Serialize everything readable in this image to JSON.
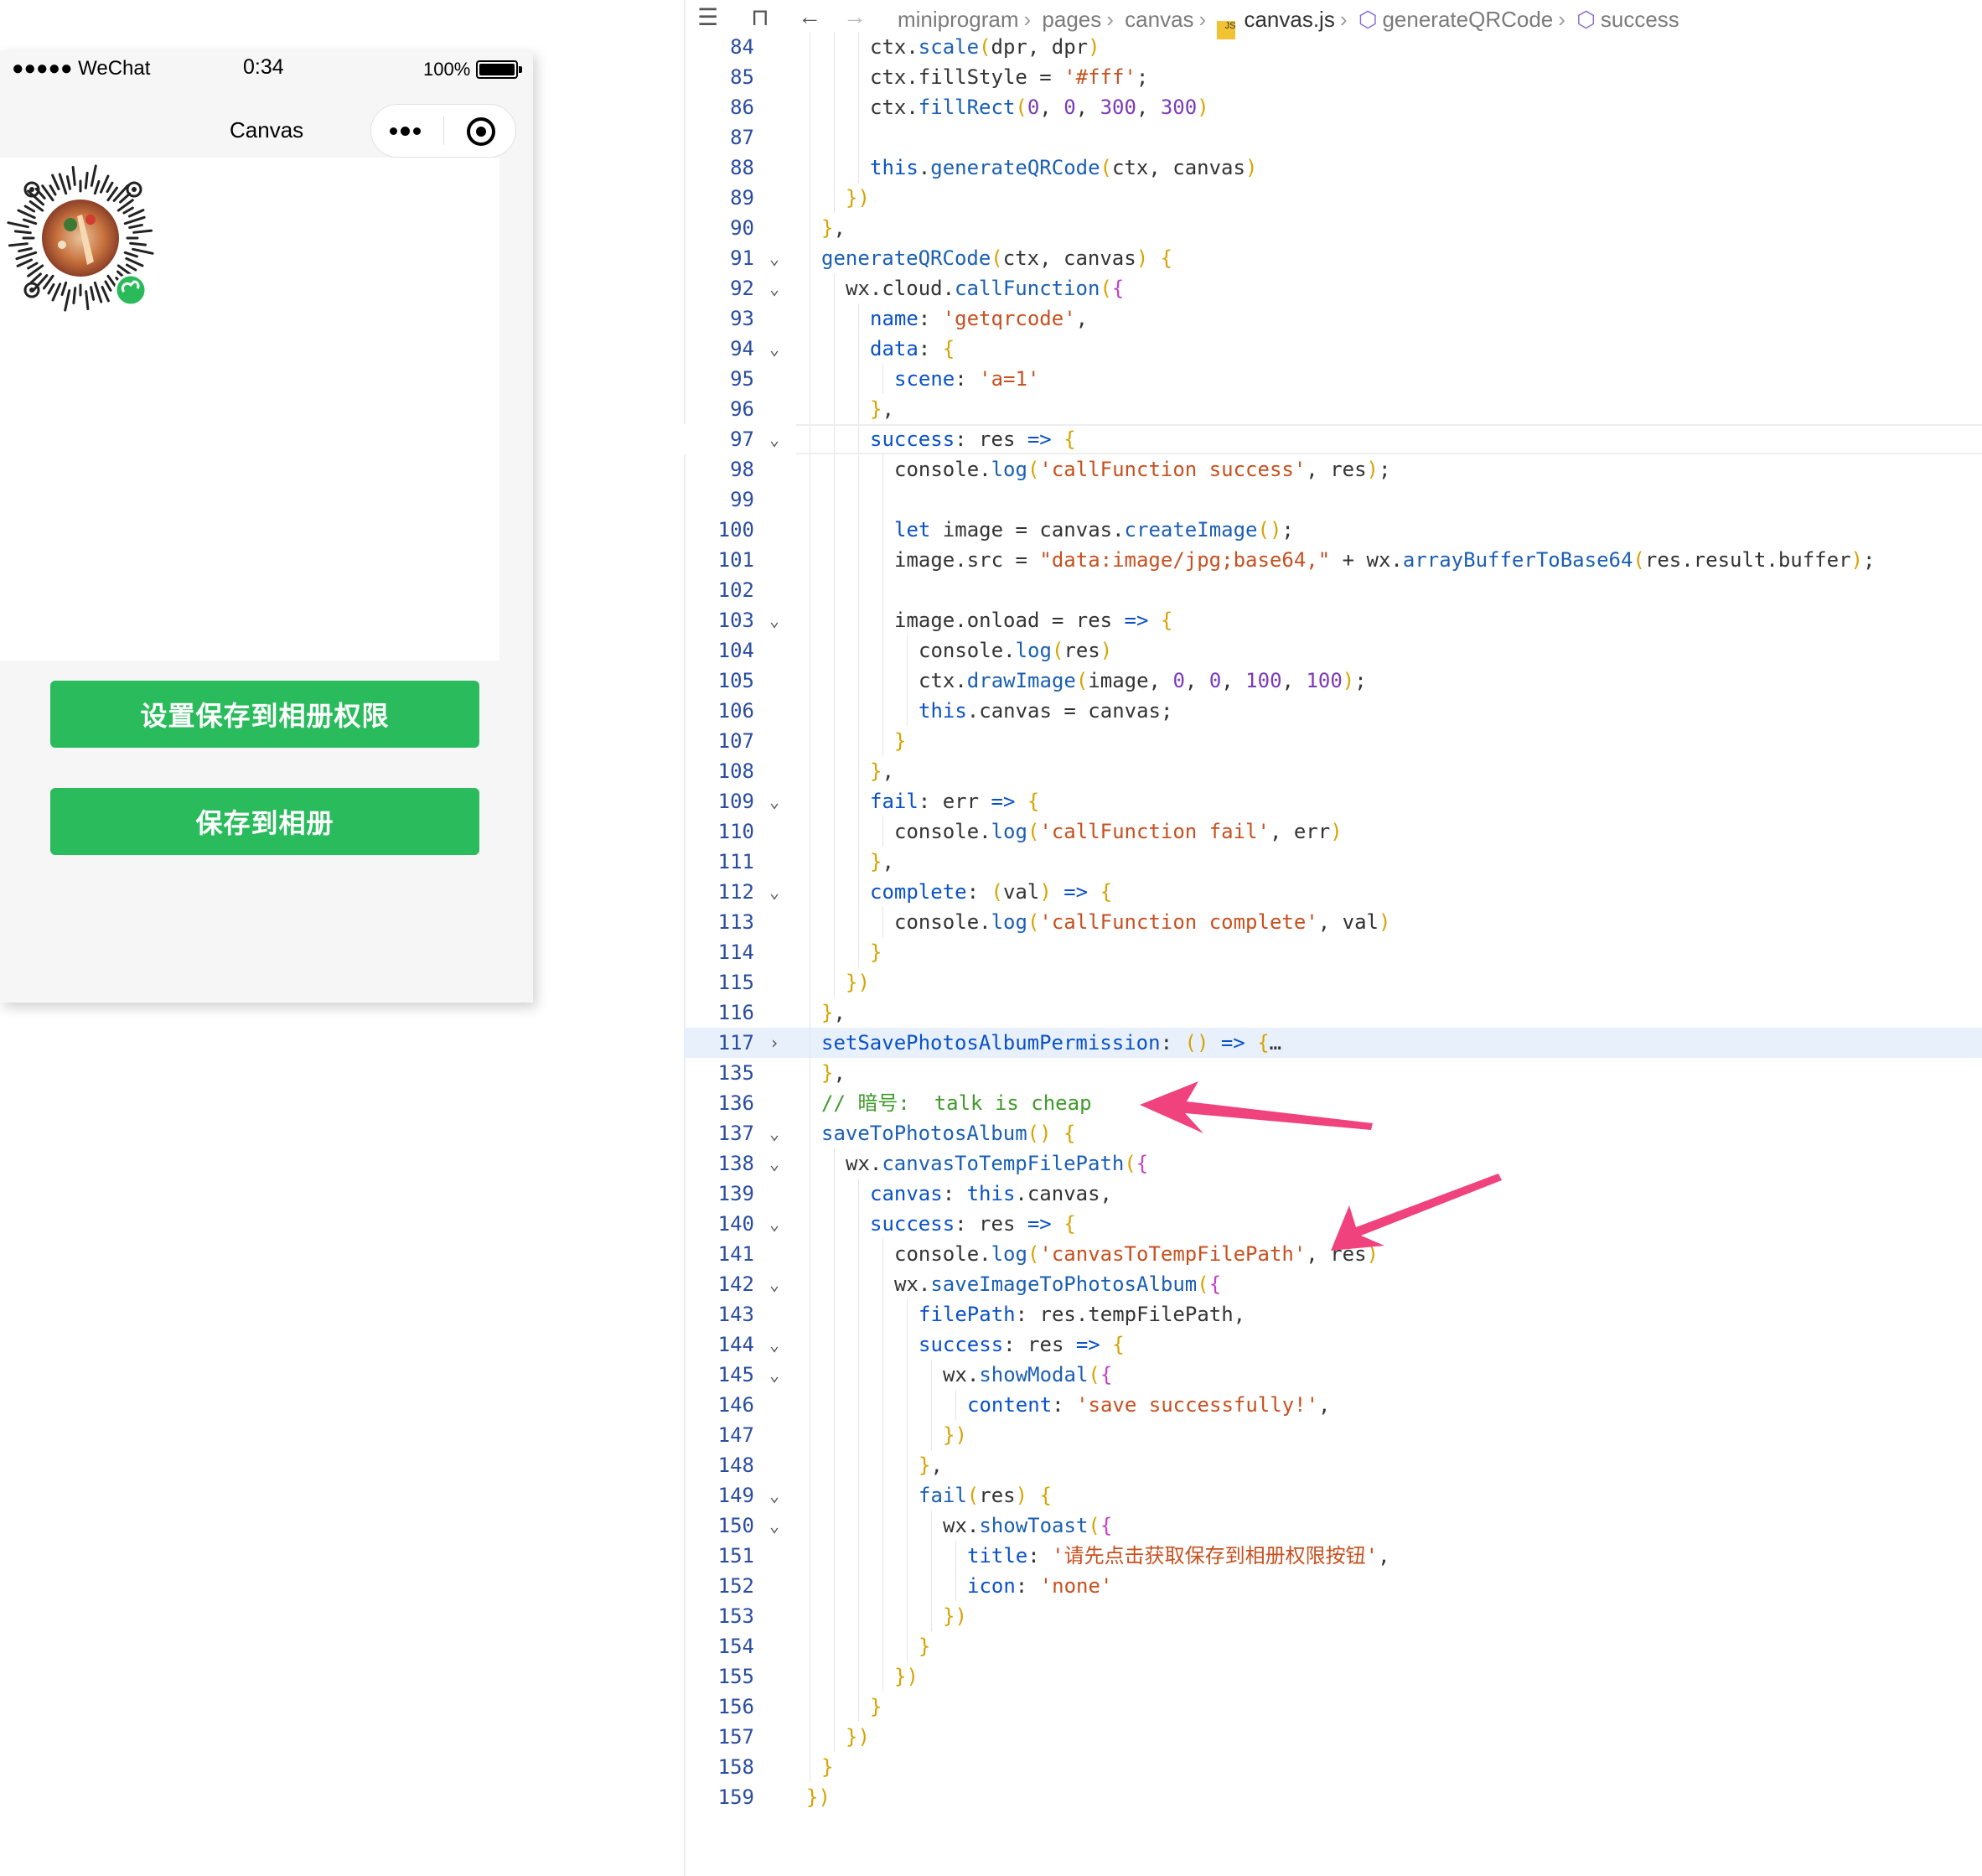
{
  "phone": {
    "status": {
      "carrier": "●●●●● WeChat",
      "time": "0:34",
      "battery": "100%"
    },
    "nav_title": "Canvas",
    "buttons": {
      "permission": "设置保存到相册权限",
      "save": "保存到相册"
    }
  },
  "editor": {
    "breadcrumb": [
      "miniprogram",
      "pages",
      "canvas",
      "canvas.js",
      "generateQRCode",
      "success"
    ],
    "lines": [
      {
        "n": "84",
        "fold": "",
        "indent": 3,
        "code": "ctx.scale(dpr, dpr)"
      },
      {
        "n": "85",
        "fold": "",
        "indent": 3,
        "code": "ctx.fillStyle = '#fff';"
      },
      {
        "n": "86",
        "fold": "",
        "indent": 3,
        "code": "ctx.fillRect(0, 0, 300, 300)"
      },
      {
        "n": "87",
        "fold": "",
        "indent": 3,
        "code": ""
      },
      {
        "n": "88",
        "fold": "",
        "indent": 3,
        "code": "this.generateQRCode(ctx, canvas)"
      },
      {
        "n": "89",
        "fold": "",
        "indent": 2,
        "code": "})"
      },
      {
        "n": "90",
        "fold": "",
        "indent": 1,
        "code": "},"
      },
      {
        "n": "91",
        "fold": "v",
        "indent": 1,
        "code": "generateQRCode(ctx, canvas) {"
      },
      {
        "n": "92",
        "fold": "v",
        "indent": 2,
        "code": "wx.cloud.callFunction({"
      },
      {
        "n": "93",
        "fold": "",
        "indent": 3,
        "code": "name: 'getqrcode',"
      },
      {
        "n": "94",
        "fold": "v",
        "indent": 3,
        "code": "data: {"
      },
      {
        "n": "95",
        "fold": "",
        "indent": 4,
        "code": "scene: 'a=1'"
      },
      {
        "n": "96",
        "fold": "",
        "indent": 3,
        "code": "},"
      },
      {
        "n": "97",
        "fold": "v",
        "indent": 3,
        "code": "success: res => {"
      },
      {
        "n": "98",
        "fold": "",
        "indent": 4,
        "code": "console.log('callFunction success', res);"
      },
      {
        "n": "99",
        "fold": "",
        "indent": 4,
        "code": ""
      },
      {
        "n": "100",
        "fold": "",
        "indent": 4,
        "code": "let image = canvas.createImage();"
      },
      {
        "n": "101",
        "fold": "",
        "indent": 4,
        "code": "image.src = \"data:image/jpg;base64,\" + wx.arrayBufferToBase64(res.result.buffer);"
      },
      {
        "n": "102",
        "fold": "",
        "indent": 4,
        "code": ""
      },
      {
        "n": "103",
        "fold": "v",
        "indent": 4,
        "code": "image.onload = res => {"
      },
      {
        "n": "104",
        "fold": "",
        "indent": 5,
        "code": "console.log(res)"
      },
      {
        "n": "105",
        "fold": "",
        "indent": 5,
        "code": "ctx.drawImage(image, 0, 0, 100, 100);"
      },
      {
        "n": "106",
        "fold": "",
        "indent": 5,
        "code": "this.canvas = canvas;"
      },
      {
        "n": "107",
        "fold": "",
        "indent": 4,
        "code": "}"
      },
      {
        "n": "108",
        "fold": "",
        "indent": 3,
        "code": "},"
      },
      {
        "n": "109",
        "fold": "v",
        "indent": 3,
        "code": "fail: err => {"
      },
      {
        "n": "110",
        "fold": "",
        "indent": 4,
        "code": "console.log('callFunction fail', err)"
      },
      {
        "n": "111",
        "fold": "",
        "indent": 3,
        "code": "},"
      },
      {
        "n": "112",
        "fold": "v",
        "indent": 3,
        "code": "complete: (val) => {"
      },
      {
        "n": "113",
        "fold": "",
        "indent": 4,
        "code": "console.log('callFunction complete', val)"
      },
      {
        "n": "114",
        "fold": "",
        "indent": 3,
        "code": "}"
      },
      {
        "n": "115",
        "fold": "",
        "indent": 2,
        "code": "})"
      },
      {
        "n": "116",
        "fold": "",
        "indent": 1,
        "code": "},"
      },
      {
        "n": "117",
        "fold": ">",
        "indent": 1,
        "code": "setSavePhotosAlbumPermission: () => {…"
      },
      {
        "n": "135",
        "fold": "",
        "indent": 1,
        "code": "},"
      },
      {
        "n": "136",
        "fold": "",
        "indent": 1,
        "code": "// 暗号:  talk is cheap"
      },
      {
        "n": "137",
        "fold": "v",
        "indent": 1,
        "code": "saveToPhotosAlbum() {"
      },
      {
        "n": "138",
        "fold": "v",
        "indent": 2,
        "code": "wx.canvasToTempFilePath({"
      },
      {
        "n": "139",
        "fold": "",
        "indent": 3,
        "code": "canvas: this.canvas,"
      },
      {
        "n": "140",
        "fold": "v",
        "indent": 3,
        "code": "success: res => {"
      },
      {
        "n": "141",
        "fold": "",
        "indent": 4,
        "code": "console.log('canvasToTempFilePath', res)"
      },
      {
        "n": "142",
        "fold": "v",
        "indent": 4,
        "code": "wx.saveImageToPhotosAlbum({"
      },
      {
        "n": "143",
        "fold": "",
        "indent": 5,
        "code": "filePath: res.tempFilePath,"
      },
      {
        "n": "144",
        "fold": "v",
        "indent": 5,
        "code": "success: res => {"
      },
      {
        "n": "145",
        "fold": "v",
        "indent": 6,
        "code": "wx.showModal({"
      },
      {
        "n": "146",
        "fold": "",
        "indent": 7,
        "code": "content: 'save successfully!',"
      },
      {
        "n": "147",
        "fold": "",
        "indent": 6,
        "code": "})"
      },
      {
        "n": "148",
        "fold": "",
        "indent": 5,
        "code": "},"
      },
      {
        "n": "149",
        "fold": "v",
        "indent": 5,
        "code": "fail(res) {"
      },
      {
        "n": "150",
        "fold": "v",
        "indent": 6,
        "code": "wx.showToast({"
      },
      {
        "n": "151",
        "fold": "",
        "indent": 7,
        "code": "title: '请先点击获取保存到相册权限按钮',"
      },
      {
        "n": "152",
        "fold": "",
        "indent": 7,
        "code": "icon: 'none'"
      },
      {
        "n": "153",
        "fold": "",
        "indent": 6,
        "code": "})"
      },
      {
        "n": "154",
        "fold": "",
        "indent": 5,
        "code": "}"
      },
      {
        "n": "155",
        "fold": "",
        "indent": 4,
        "code": "})"
      },
      {
        "n": "156",
        "fold": "",
        "indent": 3,
        "code": "}"
      },
      {
        "n": "157",
        "fold": "",
        "indent": 2,
        "code": "})"
      },
      {
        "n": "158",
        "fold": "",
        "indent": 1,
        "code": "}"
      },
      {
        "n": "159",
        "fold": "",
        "indent": 0,
        "code": "})"
      }
    ]
  }
}
